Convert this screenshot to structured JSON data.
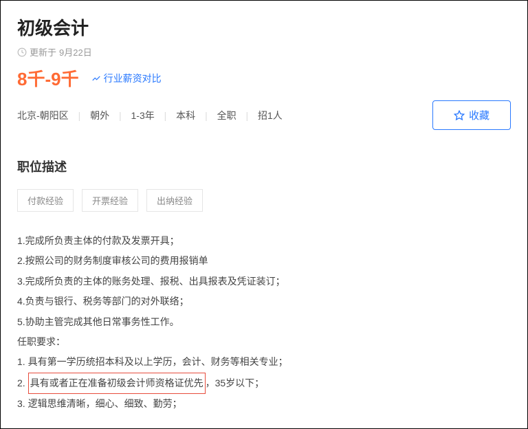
{
  "job": {
    "title": "初级会计",
    "update_prefix": "更新于",
    "update_date": "9月22日",
    "salary": "8千-9千",
    "salary_compare_label": "行业薪资对比"
  },
  "meta": {
    "location": "北京-朝阳区",
    "area": "朝外",
    "experience": "1-3年",
    "education": "本科",
    "job_type": "全职",
    "headcount": "招1人"
  },
  "buttons": {
    "collect": "收藏"
  },
  "description": {
    "section_title": "职位描述",
    "tags": [
      "付款经验",
      "开票经验",
      "出纳经验"
    ],
    "items": [
      "1.完成所负责主体的付款及发票开具；",
      "2.按照公司的财务制度审核公司的费用报销单",
      "3.完成所负责的主体的账务处理、报税、出具报表及凭证装订；",
      "4.负责与银行、税务等部门的对外联络；",
      "5.协助主管完成其他日常事务性工作。"
    ],
    "requirements_title": "任职要求：",
    "req1": "1. 具有第一学历统招本科及以上学历，会计、财务等相关专业；",
    "req2_prefix": "2. ",
    "req2_highlight": "具有或者正在准备初级会计师资格证优先",
    "req2_suffix": "，35岁以下；",
    "req3": "3. 逻辑思维清晰，细心、细致、勤劳；"
  }
}
